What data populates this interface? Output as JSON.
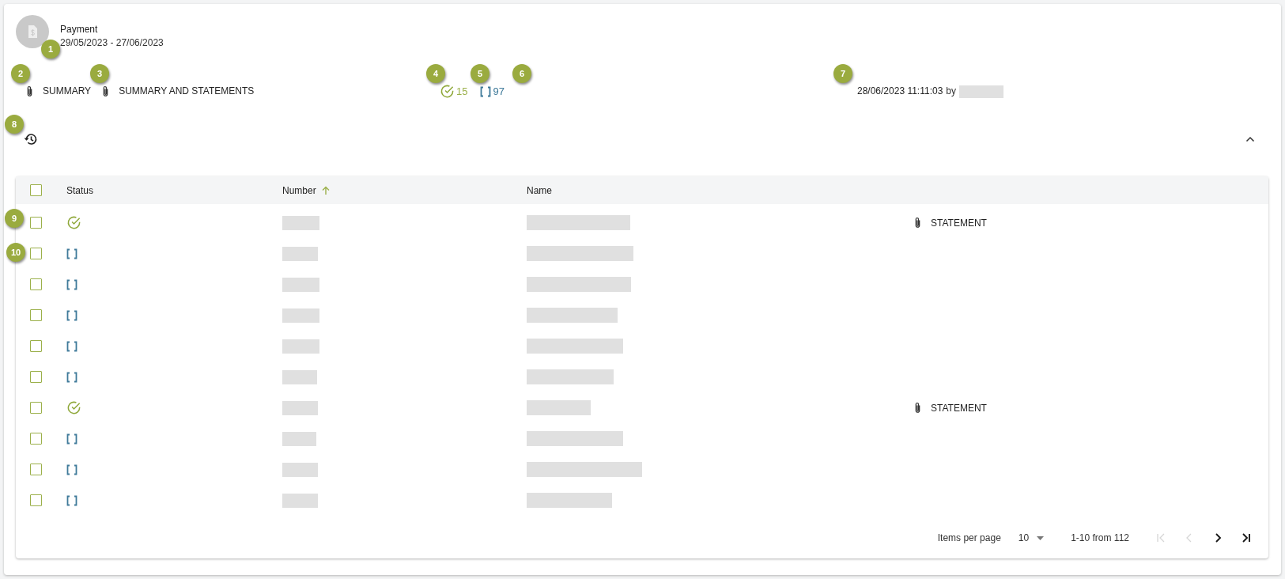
{
  "header": {
    "title": "Payment",
    "period": "29/05/2023 - 27/06/2023"
  },
  "attachments": [
    "SUMMARY",
    "SUMMARY AND STATEMENTS"
  ],
  "counters": [
    {
      "kind": "done",
      "count": "15"
    },
    {
      "kind": "pending",
      "count": "97"
    }
  ],
  "generated": {
    "timestamp": "28/06/2023 11:11:03",
    "by_label": "by"
  },
  "panel": {
    "expanded": true
  },
  "table": {
    "all_checked": false,
    "columns": [
      {
        "label": "Status"
      },
      {
        "label": "Number",
        "sorted": true
      },
      {
        "label": "Name"
      }
    ],
    "rows": [
      {
        "checked": false,
        "kind": "done",
        "attachment": "STATEMENT"
      },
      {
        "checked": false,
        "kind": "pending"
      },
      {
        "checked": false,
        "kind": "pending"
      },
      {
        "checked": false,
        "kind": "pending"
      },
      {
        "checked": false,
        "kind": "pending"
      },
      {
        "checked": false,
        "kind": "pending"
      },
      {
        "checked": false,
        "kind": "done",
        "attachment": "STATEMENT"
      },
      {
        "checked": false,
        "kind": "pending"
      },
      {
        "checked": false,
        "kind": "pending"
      },
      {
        "checked": false,
        "kind": "pending"
      }
    ]
  },
  "pagination": {
    "items_label": "Items per page",
    "page_size": "10",
    "range": "1-10 from 112",
    "buttons": [
      {
        "kind": "first",
        "disabled": true
      },
      {
        "kind": "prev",
        "disabled": true
      },
      {
        "kind": "next",
        "disabled": false
      },
      {
        "kind": "last",
        "disabled": false
      }
    ]
  },
  "callouts": [
    "1",
    "2",
    "3",
    "4",
    "5",
    "6",
    "7",
    "8",
    "9",
    "10"
  ]
}
